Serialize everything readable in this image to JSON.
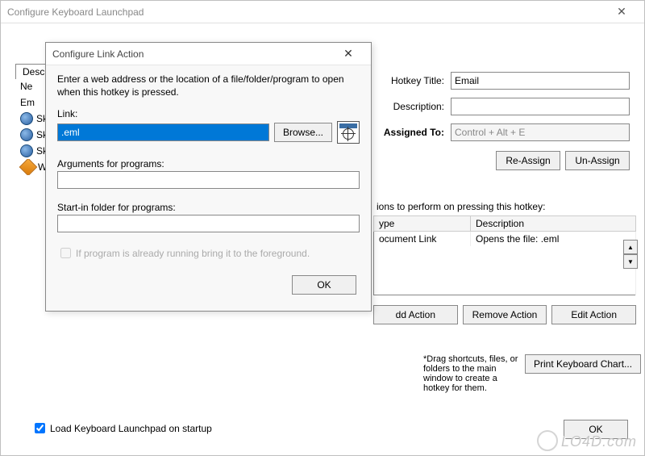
{
  "main": {
    "title": "Configure Keyboard Launchpad",
    "tab_label": "Descr",
    "list_items": [
      {
        "label": "Ne",
        "icon": ""
      },
      {
        "label": "Em",
        "icon": ""
      },
      {
        "label": "Sk",
        "icon": "globe"
      },
      {
        "label": "Sk",
        "icon": "globe"
      },
      {
        "label": "Sk",
        "icon": "globe"
      },
      {
        "label": "Wi",
        "icon": "winamp"
      }
    ],
    "fields": {
      "hotkey_title_label": "Hotkey Title:",
      "hotkey_title_value": "Email",
      "description_label": "Description:",
      "description_value": "",
      "assigned_to_label": "Assigned To:",
      "assigned_to_value": "Control + Alt + E"
    },
    "reassign_btn": "Re-Assign",
    "unassign_btn": "Un-Assign",
    "actions_label": "ions to perform on pressing this hotkey:",
    "actions_table": {
      "headers": [
        "ype",
        "Description"
      ],
      "rows": [
        [
          "ocument Link",
          "Opens the file: .eml"
        ]
      ]
    },
    "add_action_btn": "dd Action",
    "remove_action_btn": "Remove Action",
    "edit_action_btn": "Edit Action",
    "hint_text": "*Drag shortcuts, files, or folders to the main window to create a hotkey for them.",
    "print_chart_btn": "Print Keyboard Chart...",
    "startup_label": "Load Keyboard Launchpad on startup",
    "ok_btn": "OK"
  },
  "modal": {
    "title": "Configure Link Action",
    "instructions": "Enter a web address or the location of a file/folder/program to open when this hotkey is pressed.",
    "link_label": "Link:",
    "link_value": ".eml",
    "browse_btn": "Browse...",
    "args_label": "Arguments for programs:",
    "args_value": "",
    "startin_label": "Start-in folder for programs:",
    "startin_value": "",
    "foreground_label": "If program is already running bring it to the foreground.",
    "ok_btn": "OK"
  },
  "watermark": "LO4D.com"
}
